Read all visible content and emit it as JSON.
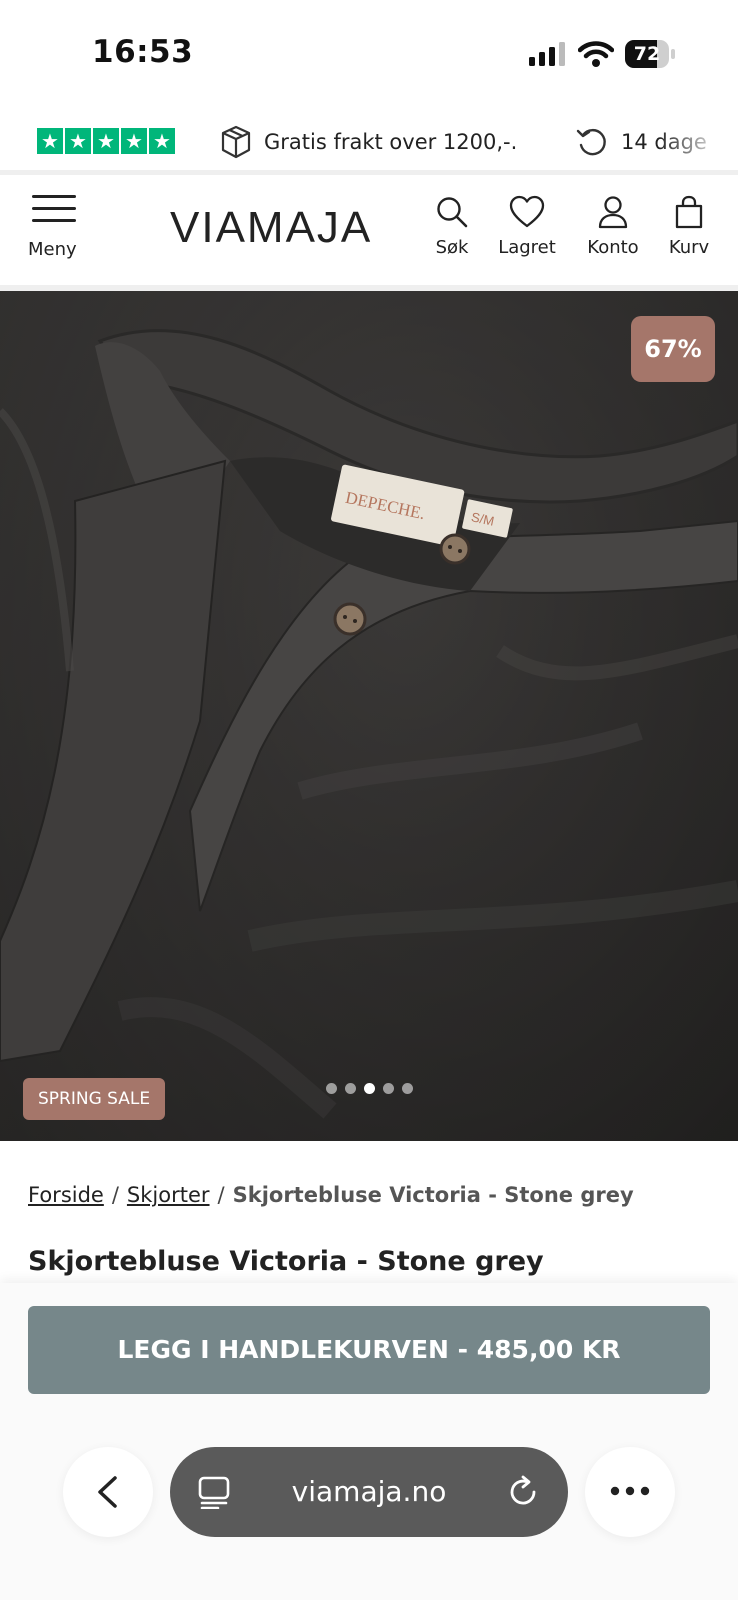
{
  "status_bar": {
    "time": "16:53",
    "battery": "72",
    "battery_level": 0.72
  },
  "usp": {
    "rating_stars": 5,
    "rating_icon": "trustpilot-star-icon",
    "shipping_text": "Gratis frakt over 1200,-.",
    "shipping_icon": "package-icon",
    "returns_text": "14 dage",
    "returns_icon": "return-arrow-icon"
  },
  "header": {
    "menu_label": "Meny",
    "logo": "VIAMAJA",
    "search_label": "Søk",
    "saved_label": "Lagret",
    "account_label": "Konto",
    "cart_label": "Kurv"
  },
  "product_image": {
    "discount_badge": "67%",
    "sale_badge": "SPRING SALE",
    "label_brand": "DEPECHE.",
    "label_size": "S/M",
    "slide_count": 5,
    "active_slide": 3
  },
  "breadcrumb": {
    "home": "Forside",
    "category": "Skjorter",
    "current": "Skjortebluse Victoria - Stone grey",
    "separator": "/"
  },
  "product": {
    "title": "Skjortebluse Victoria - Stone grey"
  },
  "cart": {
    "button_label": "LEGG I HANDLEKURVEN - 485,00 KR"
  },
  "browser": {
    "url": "viamaja.no"
  },
  "colors": {
    "accent_button": "#76878a",
    "badge": "#a5766a",
    "trustpilot": "#00b67a"
  }
}
